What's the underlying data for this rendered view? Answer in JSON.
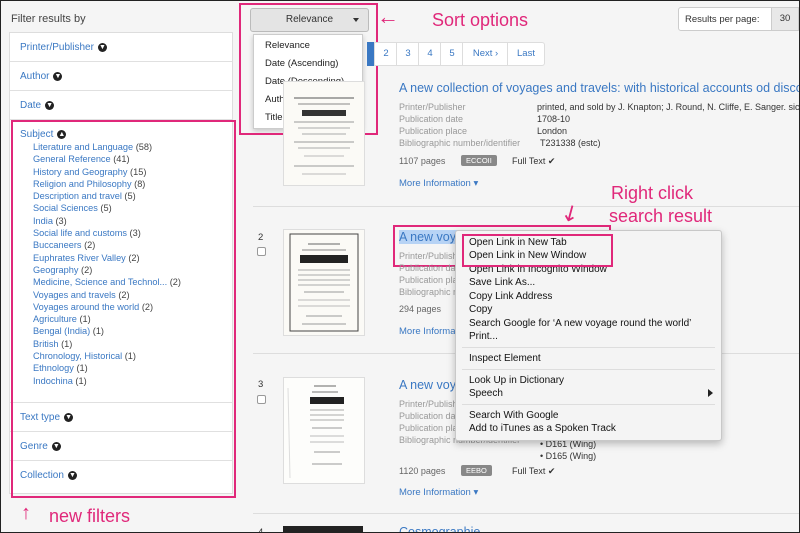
{
  "sidebar": {
    "heading": "Filter results by",
    "facets": [
      "Printer/Publisher",
      "Author",
      "Date",
      "Subject",
      "Text type",
      "Genre",
      "Collection"
    ],
    "subjects": [
      {
        "label": "Literature and Language",
        "count": "(58)"
      },
      {
        "label": "General Reference",
        "count": "(41)"
      },
      {
        "label": "History and Geography",
        "count": "(15)"
      },
      {
        "label": "Religion and Philosophy",
        "count": "(8)"
      },
      {
        "label": "Description and travel",
        "count": "(5)"
      },
      {
        "label": "Social Sciences",
        "count": "(5)"
      },
      {
        "label": "India",
        "count": "(3)"
      },
      {
        "label": "Social life and customs",
        "count": "(3)"
      },
      {
        "label": "Buccaneers",
        "count": "(2)"
      },
      {
        "label": "Euphrates River Valley",
        "count": "(2)"
      },
      {
        "label": "Geography",
        "count": "(2)"
      },
      {
        "label": "Medicine, Science and Technol...",
        "count": "(2)"
      },
      {
        "label": "Voyages and travels",
        "count": "(2)"
      },
      {
        "label": "Voyages around the world",
        "count": "(2)"
      },
      {
        "label": "Agriculture",
        "count": "(1)"
      },
      {
        "label": "Bengal (India)",
        "count": "(1)"
      },
      {
        "label": "British",
        "count": "(1)"
      },
      {
        "label": "Chronology, Historical",
        "count": "(1)"
      },
      {
        "label": "Ethnology",
        "count": "(1)"
      },
      {
        "label": "Indochina",
        "count": "(1)"
      }
    ]
  },
  "sort": {
    "button_label": "Relevance",
    "options": [
      "Relevance",
      "Date (Ascending)",
      "Date (Descending)",
      "Author (A-Z)",
      "Title (A-Z)"
    ]
  },
  "pagination": [
    "2",
    "3",
    "4",
    "5",
    "Next ›",
    "Last"
  ],
  "per_page": {
    "label": "Results per page:",
    "value": "30"
  },
  "results": [
    {
      "number": "",
      "title": "A new collection of voyages and travels: with historical accounts od discove",
      "meta": [
        {
          "k": "Printer/Publisher",
          "v": "printed, and sold by J. Knapton; J. Round, N. Cliffe, E. Sanger. sic and"
        },
        {
          "k": "Publication date",
          "v": "1708-10"
        },
        {
          "k": "Publication place",
          "v": "London"
        },
        {
          "k": "Bibliographic number/identifier",
          "v": "T231338 (estc)"
        }
      ],
      "pages": "1107 pages",
      "badge": "ECCOII",
      "fulltext": "Full Text ✔",
      "more": "More Information ▾"
    },
    {
      "number": "2",
      "title": "A new voyage round the world",
      "meta": [
        {
          "k": "Printer/Publisher",
          "v": ""
        },
        {
          "k": "Publication date",
          "v": ""
        },
        {
          "k": "Publication place",
          "v": ""
        },
        {
          "k": "Bibliographic number/identifier",
          "v": ""
        }
      ],
      "pages": "294 pages",
      "more": "More Information"
    },
    {
      "number": "3",
      "title": "A new voyage round the world",
      "meta": [
        {
          "k": "Printer/Publisher",
          "v": ""
        },
        {
          "k": "Publication date",
          "v": ""
        },
        {
          "k": "Publication place",
          "v": ""
        },
        {
          "k": "Bibliographic number/identifier",
          "v": ""
        }
      ],
      "extra_ids": [
        "D161 (Wing)",
        "D165 (Wing)"
      ],
      "pages": "1120 pages",
      "badge": "EEBO",
      "fulltext": "Full Text ✔",
      "more": "More Information ▾"
    },
    {
      "number": "4",
      "title": "Cosmographie"
    }
  ],
  "context_menu": {
    "items": [
      "Open Link in New Tab",
      "Open Link in New Window",
      "Open Link in Incognito Window",
      "Save Link As...",
      "Copy Link Address",
      "Copy",
      "Search Google for ‘A new voyage round the world’",
      "Print...",
      "Inspect Element",
      "Look Up in Dictionary",
      "Speech",
      "Search With Google",
      "Add to iTunes as a Spoken Track"
    ]
  },
  "annotations": {
    "sort_options": "Sort options",
    "right_click_line1": "Right click",
    "right_click_line2": "search result",
    "new_filters": "new filters"
  },
  "colors": {
    "annotation": "#e0287a",
    "link": "#3a78c3",
    "active_page": "#3a78c3"
  }
}
